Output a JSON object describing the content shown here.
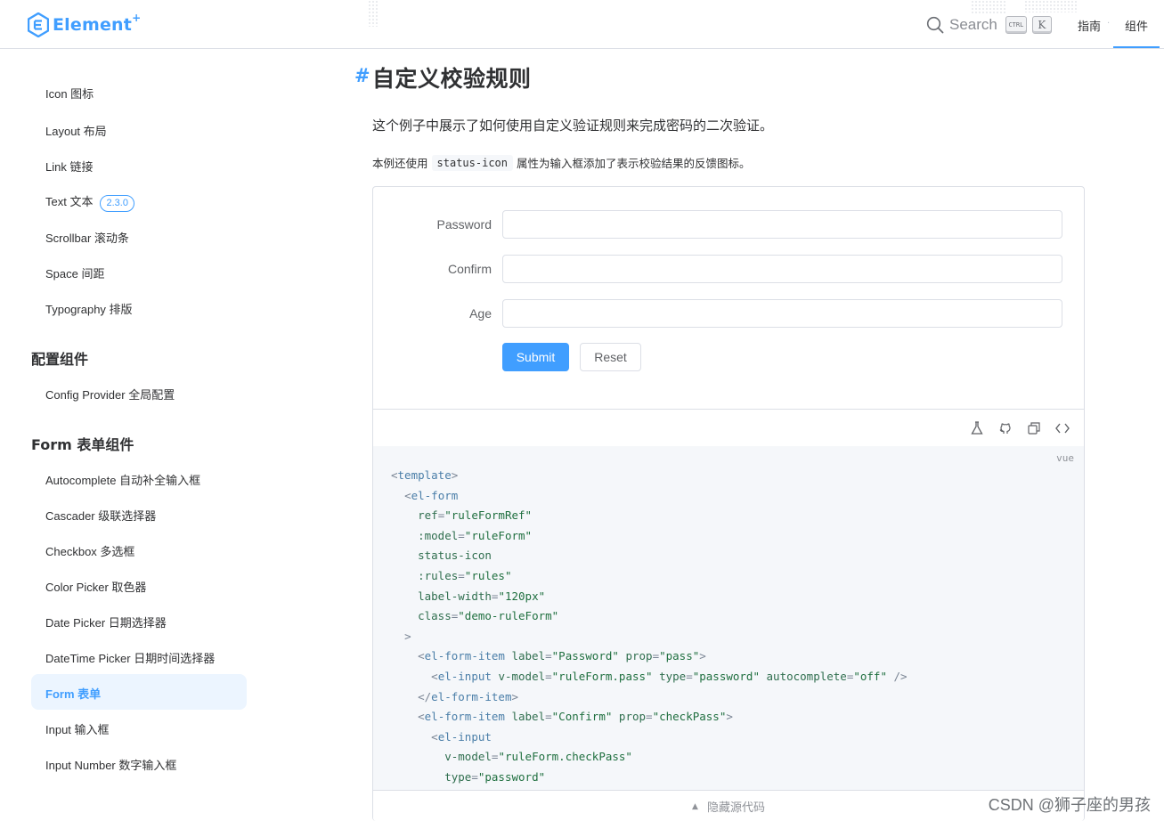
{
  "header": {
    "logo_text": "Element",
    "logo_plus": "+",
    "search_label": "Search",
    "kbd_ctrl": "CTRL",
    "kbd_k": "K",
    "nav": [
      "指南",
      "组件"
    ],
    "active_nav": "组件",
    "accent_color": "#409eff"
  },
  "sidebar": {
    "items_top": [
      {
        "label": "Icon 图标"
      },
      {
        "label": "Layout 布局"
      },
      {
        "label": "Link 链接"
      },
      {
        "label": "Text 文本",
        "badge": "2.3.0"
      },
      {
        "label": "Scrollbar 滚动条"
      },
      {
        "label": "Space 间距"
      },
      {
        "label": "Typography 排版"
      }
    ],
    "group_config": "配置组件",
    "config_items": [
      {
        "label": "Config Provider 全局配置"
      }
    ],
    "group_form": "Form 表单组件",
    "form_items": [
      {
        "label": "Autocomplete 自动补全输入框"
      },
      {
        "label": "Cascader 级联选择器"
      },
      {
        "label": "Checkbox 多选框"
      },
      {
        "label": "Color Picker 取色器"
      },
      {
        "label": "Date Picker 日期选择器"
      },
      {
        "label": "DateTime Picker 日期时间选择器"
      },
      {
        "label": "Form 表单",
        "active": true
      },
      {
        "label": "Input 输入框"
      },
      {
        "label": "Input Number 数字输入框"
      }
    ]
  },
  "main": {
    "hash": "#",
    "title": "自定义校验规则",
    "para1": "这个例子中展示了如何使用自定义验证规则来完成密码的二次验证。",
    "para2_before": "本例还使用",
    "para2_code": "status-icon",
    "para2_after": "属性为输入框添加了表示校验结果的反馈图标。"
  },
  "demo": {
    "fields": [
      {
        "label": "Password",
        "value": ""
      },
      {
        "label": "Confirm",
        "value": ""
      },
      {
        "label": "Age",
        "value": ""
      }
    ],
    "submit_label": "Submit",
    "reset_label": "Reset",
    "toolbar_icons": [
      "playground-icon",
      "github-icon",
      "copy-icon",
      "code-icon"
    ],
    "code_lang": "vue",
    "hide_source_label": "隐藏源代码"
  },
  "code_lines": [
    [
      [
        "p",
        "<"
      ],
      [
        "t",
        "template"
      ],
      [
        "p",
        ">"
      ]
    ],
    [
      [
        "s",
        "  "
      ],
      [
        "p",
        "<"
      ],
      [
        "t",
        "el-form"
      ]
    ],
    [
      [
        "s",
        "    "
      ],
      [
        "a",
        "ref"
      ],
      [
        "p",
        "="
      ],
      [
        "q",
        "\"ruleFormRef\""
      ]
    ],
    [
      [
        "s",
        "    "
      ],
      [
        "a",
        ":model"
      ],
      [
        "p",
        "="
      ],
      [
        "q",
        "\"ruleForm\""
      ]
    ],
    [
      [
        "s",
        "    "
      ],
      [
        "a",
        "status-icon"
      ]
    ],
    [
      [
        "s",
        "    "
      ],
      [
        "a",
        ":rules"
      ],
      [
        "p",
        "="
      ],
      [
        "q",
        "\"rules\""
      ]
    ],
    [
      [
        "s",
        "    "
      ],
      [
        "a",
        "label-width"
      ],
      [
        "p",
        "="
      ],
      [
        "q",
        "\"120px\""
      ]
    ],
    [
      [
        "s",
        "    "
      ],
      [
        "a",
        "class"
      ],
      [
        "p",
        "="
      ],
      [
        "q",
        "\"demo-ruleForm\""
      ]
    ],
    [
      [
        "s",
        "  "
      ],
      [
        "p",
        ">"
      ]
    ],
    [
      [
        "s",
        "    "
      ],
      [
        "p",
        "<"
      ],
      [
        "t",
        "el-form-item"
      ],
      [
        "s",
        " "
      ],
      [
        "a",
        "label"
      ],
      [
        "p",
        "="
      ],
      [
        "q",
        "\"Password\""
      ],
      [
        "s",
        " "
      ],
      [
        "a",
        "prop"
      ],
      [
        "p",
        "="
      ],
      [
        "q",
        "\"pass\""
      ],
      [
        "p",
        ">"
      ]
    ],
    [
      [
        "s",
        "      "
      ],
      [
        "p",
        "<"
      ],
      [
        "t",
        "el-input"
      ],
      [
        "s",
        " "
      ],
      [
        "a",
        "v-model"
      ],
      [
        "p",
        "="
      ],
      [
        "q",
        "\"ruleForm.pass\""
      ],
      [
        "s",
        " "
      ],
      [
        "a",
        "type"
      ],
      [
        "p",
        "="
      ],
      [
        "q",
        "\"password\""
      ],
      [
        "s",
        " "
      ],
      [
        "a",
        "autocomplete"
      ],
      [
        "p",
        "="
      ],
      [
        "q",
        "\"off\""
      ],
      [
        "s",
        " "
      ],
      [
        "p",
        "/>"
      ]
    ],
    [
      [
        "s",
        "    "
      ],
      [
        "p",
        "</"
      ],
      [
        "t",
        "el-form-item"
      ],
      [
        "p",
        ">"
      ]
    ],
    [
      [
        "s",
        "    "
      ],
      [
        "p",
        "<"
      ],
      [
        "t",
        "el-form-item"
      ],
      [
        "s",
        " "
      ],
      [
        "a",
        "label"
      ],
      [
        "p",
        "="
      ],
      [
        "q",
        "\"Confirm\""
      ],
      [
        "s",
        " "
      ],
      [
        "a",
        "prop"
      ],
      [
        "p",
        "="
      ],
      [
        "q",
        "\"checkPass\""
      ],
      [
        "p",
        ">"
      ]
    ],
    [
      [
        "s",
        "      "
      ],
      [
        "p",
        "<"
      ],
      [
        "t",
        "el-input"
      ]
    ],
    [
      [
        "s",
        "        "
      ],
      [
        "a",
        "v-model"
      ],
      [
        "p",
        "="
      ],
      [
        "q",
        "\"ruleForm.checkPass\""
      ]
    ],
    [
      [
        "s",
        "        "
      ],
      [
        "a",
        "type"
      ],
      [
        "p",
        "="
      ],
      [
        "q",
        "\"password\""
      ]
    ]
  ],
  "watermark": "CSDN @狮子座的男孩"
}
